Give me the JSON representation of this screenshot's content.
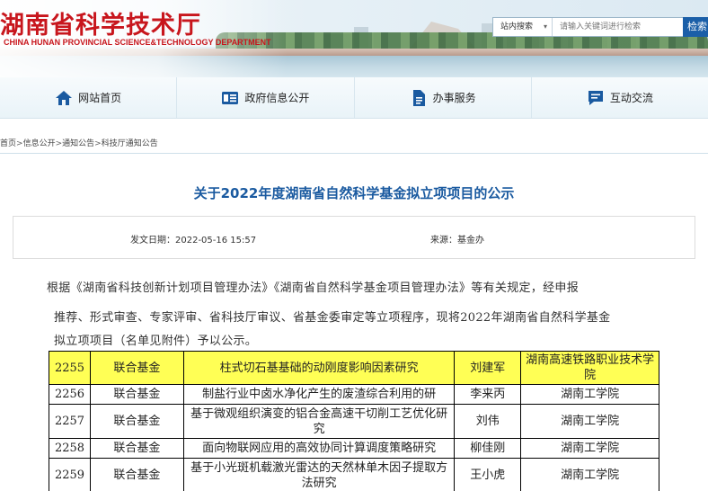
{
  "header": {
    "site_title": "湖南省科学技术厅",
    "site_subtitle": "CHINA HUNAN PROVINCIAL SCIENCE&TECHNOLOGY DEPARTMENT",
    "search": {
      "scope": "站内搜索",
      "placeholder": "请输入关键词进行检索",
      "button": "检索"
    }
  },
  "nav": {
    "items": [
      {
        "label": "网站首页",
        "icon": "home-icon"
      },
      {
        "label": "政府信息公开",
        "icon": "info-card-icon"
      },
      {
        "label": "办事服务",
        "icon": "document-icon"
      },
      {
        "label": "互动交流",
        "icon": "chat-icon"
      }
    ]
  },
  "breadcrumb": {
    "items": [
      "首页",
      "信息公开",
      "通知公告",
      "科技厅通知公告"
    ],
    "separator": ">"
  },
  "article": {
    "title": "关于2022年度湖南省自然科学基金拟立项项目的公示",
    "date_label": "发文日期：",
    "date": "2022-05-16 15:57",
    "source_label": "来源：",
    "source": "基金办",
    "paragraph_lines": [
      "根据《湖南省科技创新计划项目管理办法》《湖南省自然科学基金项目管理办法》等有关规定，经申报",
      "推荐、形式审查、专家评审、省科技厅审议、省基金委审定等立项程序，现将2022年湖南省自然科学基金",
      "拟立项项目（名单见附件）予以公示。"
    ]
  },
  "table": {
    "highlight_color": "#ffff55",
    "rows": [
      {
        "no": "2255",
        "type": "联合基金",
        "title": "柱式切石基基础的动刚度影响因素研究",
        "person": "刘建军",
        "unit": "湖南高速铁路职业技术学院",
        "highlight": true
      },
      {
        "no": "2256",
        "type": "联合基金",
        "title": "制盐行业中卤水净化产生的废渣综合利用的研",
        "person": "李来丙",
        "unit": "湖南工学院",
        "highlight": false
      },
      {
        "no": "2257",
        "type": "联合基金",
        "title": "基于微观组织演变的铝合金高速干切削工艺优化研究",
        "person": "刘伟",
        "unit": "湖南工学院",
        "highlight": false
      },
      {
        "no": "2258",
        "type": "联合基金",
        "title": "面向物联网应用的高效协同计算调度策略研究",
        "person": "柳佳刚",
        "unit": "湖南工学院",
        "highlight": false
      },
      {
        "no": "2259",
        "type": "联合基金",
        "title": "基于小光斑机载激光雷达的天然林单木因子提取方法研究",
        "person": "王小虎",
        "unit": "湖南工学院",
        "highlight": false
      }
    ]
  }
}
